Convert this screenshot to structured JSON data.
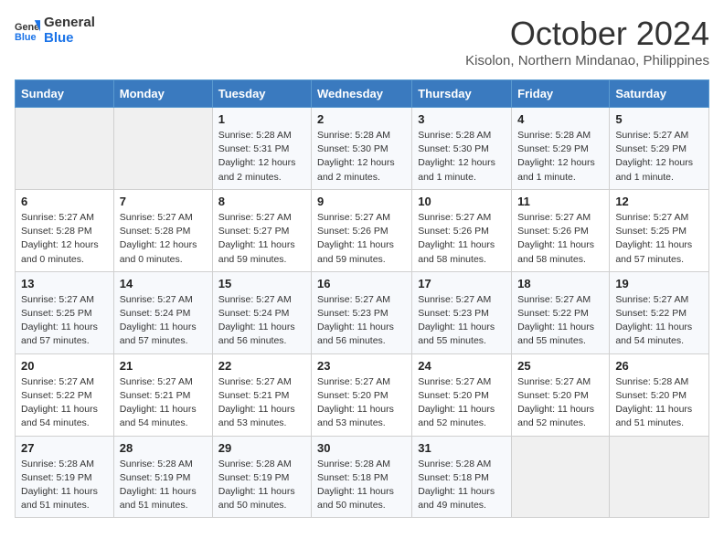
{
  "header": {
    "logo_line1": "General",
    "logo_line2": "Blue",
    "month": "October 2024",
    "location": "Kisolon, Northern Mindanao, Philippines"
  },
  "days_of_week": [
    "Sunday",
    "Monday",
    "Tuesday",
    "Wednesday",
    "Thursday",
    "Friday",
    "Saturday"
  ],
  "weeks": [
    [
      {
        "day": "",
        "info": ""
      },
      {
        "day": "",
        "info": ""
      },
      {
        "day": "1",
        "info": "Sunrise: 5:28 AM\nSunset: 5:31 PM\nDaylight: 12 hours and 2 minutes."
      },
      {
        "day": "2",
        "info": "Sunrise: 5:28 AM\nSunset: 5:30 PM\nDaylight: 12 hours and 2 minutes."
      },
      {
        "day": "3",
        "info": "Sunrise: 5:28 AM\nSunset: 5:30 PM\nDaylight: 12 hours and 1 minute."
      },
      {
        "day": "4",
        "info": "Sunrise: 5:28 AM\nSunset: 5:29 PM\nDaylight: 12 hours and 1 minute."
      },
      {
        "day": "5",
        "info": "Sunrise: 5:27 AM\nSunset: 5:29 PM\nDaylight: 12 hours and 1 minute."
      }
    ],
    [
      {
        "day": "6",
        "info": "Sunrise: 5:27 AM\nSunset: 5:28 PM\nDaylight: 12 hours and 0 minutes."
      },
      {
        "day": "7",
        "info": "Sunrise: 5:27 AM\nSunset: 5:28 PM\nDaylight: 12 hours and 0 minutes."
      },
      {
        "day": "8",
        "info": "Sunrise: 5:27 AM\nSunset: 5:27 PM\nDaylight: 11 hours and 59 minutes."
      },
      {
        "day": "9",
        "info": "Sunrise: 5:27 AM\nSunset: 5:26 PM\nDaylight: 11 hours and 59 minutes."
      },
      {
        "day": "10",
        "info": "Sunrise: 5:27 AM\nSunset: 5:26 PM\nDaylight: 11 hours and 58 minutes."
      },
      {
        "day": "11",
        "info": "Sunrise: 5:27 AM\nSunset: 5:26 PM\nDaylight: 11 hours and 58 minutes."
      },
      {
        "day": "12",
        "info": "Sunrise: 5:27 AM\nSunset: 5:25 PM\nDaylight: 11 hours and 57 minutes."
      }
    ],
    [
      {
        "day": "13",
        "info": "Sunrise: 5:27 AM\nSunset: 5:25 PM\nDaylight: 11 hours and 57 minutes."
      },
      {
        "day": "14",
        "info": "Sunrise: 5:27 AM\nSunset: 5:24 PM\nDaylight: 11 hours and 57 minutes."
      },
      {
        "day": "15",
        "info": "Sunrise: 5:27 AM\nSunset: 5:24 PM\nDaylight: 11 hours and 56 minutes."
      },
      {
        "day": "16",
        "info": "Sunrise: 5:27 AM\nSunset: 5:23 PM\nDaylight: 11 hours and 56 minutes."
      },
      {
        "day": "17",
        "info": "Sunrise: 5:27 AM\nSunset: 5:23 PM\nDaylight: 11 hours and 55 minutes."
      },
      {
        "day": "18",
        "info": "Sunrise: 5:27 AM\nSunset: 5:22 PM\nDaylight: 11 hours and 55 minutes."
      },
      {
        "day": "19",
        "info": "Sunrise: 5:27 AM\nSunset: 5:22 PM\nDaylight: 11 hours and 54 minutes."
      }
    ],
    [
      {
        "day": "20",
        "info": "Sunrise: 5:27 AM\nSunset: 5:22 PM\nDaylight: 11 hours and 54 minutes."
      },
      {
        "day": "21",
        "info": "Sunrise: 5:27 AM\nSunset: 5:21 PM\nDaylight: 11 hours and 54 minutes."
      },
      {
        "day": "22",
        "info": "Sunrise: 5:27 AM\nSunset: 5:21 PM\nDaylight: 11 hours and 53 minutes."
      },
      {
        "day": "23",
        "info": "Sunrise: 5:27 AM\nSunset: 5:20 PM\nDaylight: 11 hours and 53 minutes."
      },
      {
        "day": "24",
        "info": "Sunrise: 5:27 AM\nSunset: 5:20 PM\nDaylight: 11 hours and 52 minutes."
      },
      {
        "day": "25",
        "info": "Sunrise: 5:27 AM\nSunset: 5:20 PM\nDaylight: 11 hours and 52 minutes."
      },
      {
        "day": "26",
        "info": "Sunrise: 5:28 AM\nSunset: 5:20 PM\nDaylight: 11 hours and 51 minutes."
      }
    ],
    [
      {
        "day": "27",
        "info": "Sunrise: 5:28 AM\nSunset: 5:19 PM\nDaylight: 11 hours and 51 minutes."
      },
      {
        "day": "28",
        "info": "Sunrise: 5:28 AM\nSunset: 5:19 PM\nDaylight: 11 hours and 51 minutes."
      },
      {
        "day": "29",
        "info": "Sunrise: 5:28 AM\nSunset: 5:19 PM\nDaylight: 11 hours and 50 minutes."
      },
      {
        "day": "30",
        "info": "Sunrise: 5:28 AM\nSunset: 5:18 PM\nDaylight: 11 hours and 50 minutes."
      },
      {
        "day": "31",
        "info": "Sunrise: 5:28 AM\nSunset: 5:18 PM\nDaylight: 11 hours and 49 minutes."
      },
      {
        "day": "",
        "info": ""
      },
      {
        "day": "",
        "info": ""
      }
    ]
  ]
}
